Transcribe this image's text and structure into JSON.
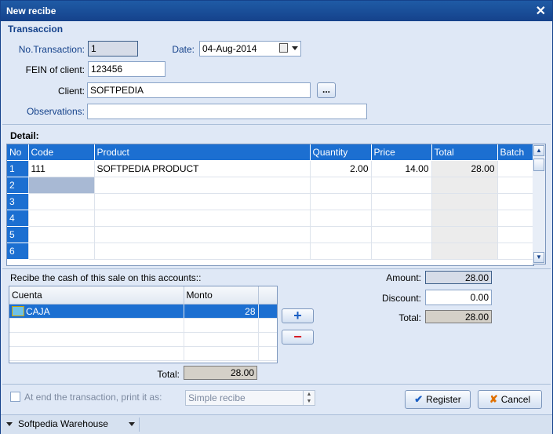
{
  "window": {
    "title": "New recibe",
    "close_glyph": "✕"
  },
  "transaction": {
    "section_title": "Transaccion",
    "no_label": "No.Transaction:",
    "no_value": "1",
    "date_label": "Date:",
    "date_value": "04-Aug-2014",
    "fein_label": "FEIN of client:",
    "fein_value": "123456",
    "client_label": "Client:",
    "client_value": "SOFTPEDIA",
    "client_browse": "...",
    "observations_label": "Observations:",
    "observations_value": ""
  },
  "detail": {
    "section_title": "Detail:",
    "columns": [
      "No",
      "Code",
      "Product",
      "Quantity",
      "Price",
      "Total",
      "Batch"
    ],
    "rows": [
      {
        "no": "1",
        "code": "111",
        "product": "SOFTPEDIA PRODUCT",
        "quantity": "2.00",
        "price": "14.00",
        "total": "28.00",
        "batch": ""
      },
      {
        "no": "2",
        "code": "",
        "product": "",
        "quantity": "",
        "price": "",
        "total": "",
        "batch": ""
      },
      {
        "no": "3",
        "code": "",
        "product": "",
        "quantity": "",
        "price": "",
        "total": "",
        "batch": ""
      },
      {
        "no": "4",
        "code": "",
        "product": "",
        "quantity": "",
        "price": "",
        "total": "",
        "batch": ""
      },
      {
        "no": "5",
        "code": "",
        "product": "",
        "quantity": "",
        "price": "",
        "total": "",
        "batch": ""
      },
      {
        "no": "6",
        "code": "",
        "product": "",
        "quantity": "",
        "price": "",
        "total": "",
        "batch": ""
      }
    ]
  },
  "accounts": {
    "label": "Recibe the cash of this sale on this accounts::",
    "columns": [
      "Cuenta",
      "Monto"
    ],
    "rows": [
      {
        "cuenta": "CAJA",
        "monto": "28"
      }
    ],
    "add_glyph": "+",
    "remove_glyph": "−",
    "total_label": "Total:",
    "total_value": "28.00"
  },
  "summary": {
    "amount_label": "Amount:",
    "amount_value": "28.00",
    "discount_label": "Discount:",
    "discount_value": "0.00",
    "total_label": "Total:",
    "total_value": "28.00"
  },
  "footer": {
    "print_label": "At end the transaction, print it as:",
    "print_select": "Simple recibe",
    "register_label": "Register",
    "cancel_label": "Cancel"
  },
  "statusbar": {
    "warehouse": "Softpedia Warehouse"
  },
  "colors": {
    "accent": "#1c6fd1",
    "title": "#15428b",
    "background": "#dfe8f6"
  }
}
